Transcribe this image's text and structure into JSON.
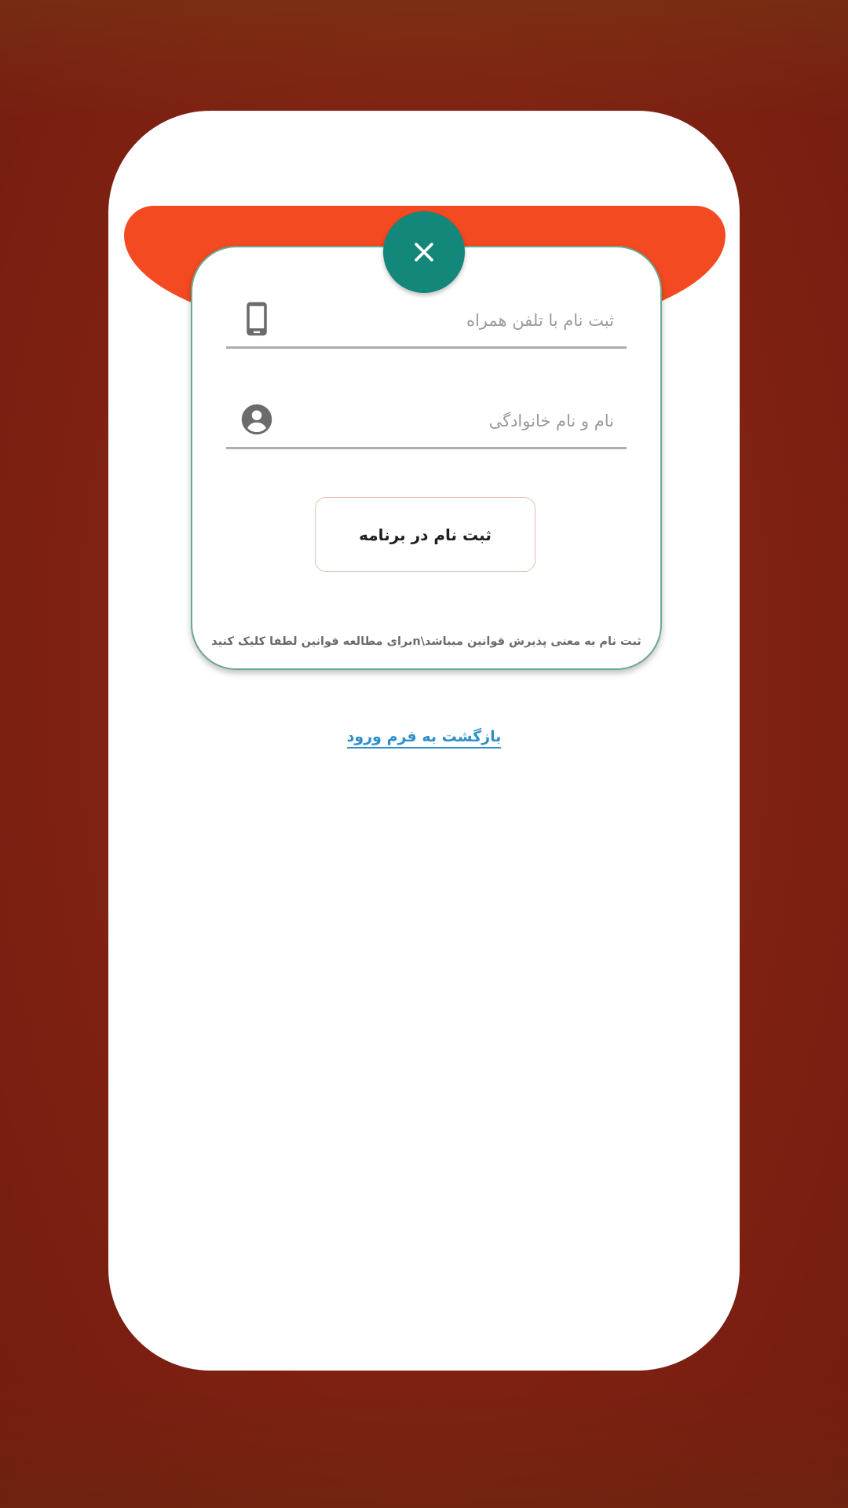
{
  "register_form": {
    "phone_field": {
      "placeholder": "ثبت نام با تلفن همراه",
      "value": "",
      "icon": "mobile-phone-icon"
    },
    "name_field": {
      "placeholder": "نام و نام خانوادگی",
      "value": "",
      "icon": "account-circle-icon"
    },
    "submit_label": "ثبت نام در برنامه",
    "terms_text": "ثبت نام به معنی پذیرش قوانین میباشد\\nبرای مطالعه قوانین لطفا کلیک کنید",
    "close_icon": "close-icon"
  },
  "back_link_label": "بازگشت به فرم ورود",
  "colors": {
    "background": "#7e2112",
    "header_band": "#f44a22",
    "close_button": "#13877a",
    "card_border": "#6aa98f",
    "link": "#2f8fc9"
  }
}
